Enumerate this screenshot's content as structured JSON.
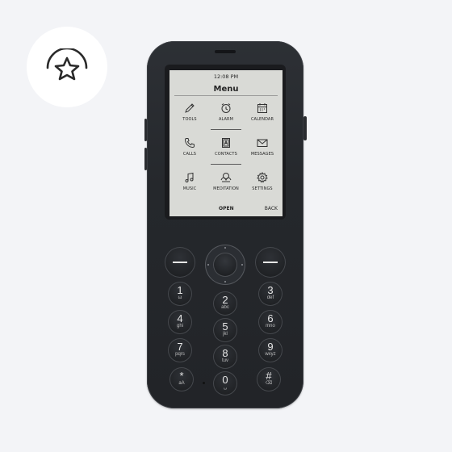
{
  "badge": {
    "icon": "star-upgrade-icon"
  },
  "screen": {
    "time": "12:08 PM",
    "title": "Menu",
    "apps": [
      {
        "label": "TOOLS",
        "icon": "pencil-icon"
      },
      {
        "label": "ALARM",
        "icon": "alarm-clock-icon"
      },
      {
        "label": "CALENDAR",
        "icon": "calendar-icon"
      },
      {
        "label": "CALLS",
        "icon": "phone-icon"
      },
      {
        "label": "CONTACTS",
        "icon": "contacts-icon"
      },
      {
        "label": "MESSAGES",
        "icon": "envelope-icon"
      },
      {
        "label": "MUSIC",
        "icon": "music-note-icon"
      },
      {
        "label": "MEDITATION",
        "icon": "meditation-icon"
      },
      {
        "label": "SETTINGS",
        "icon": "gear-icon"
      }
    ],
    "softkeys": {
      "left": "OPEN",
      "right": "BACK"
    }
  },
  "keypad": [
    {
      "digit": "1",
      "letters": "ω"
    },
    {
      "digit": "2",
      "letters": "abc"
    },
    {
      "digit": "3",
      "letters": "def"
    },
    {
      "digit": "4",
      "letters": "ghi"
    },
    {
      "digit": "5",
      "letters": "jkl"
    },
    {
      "digit": "6",
      "letters": "mno"
    },
    {
      "digit": "7",
      "letters": "pqrs"
    },
    {
      "digit": "8",
      "letters": "tuv"
    },
    {
      "digit": "9",
      "letters": "wxyz"
    },
    {
      "digit": "*",
      "letters": "aA"
    },
    {
      "digit": "0",
      "letters": "␣"
    },
    {
      "digit": "#",
      "letters": "⌫"
    }
  ],
  "colors": {
    "background": "#f3f4f7",
    "phone_body": "#25282c",
    "screen": "#d9dad6"
  }
}
